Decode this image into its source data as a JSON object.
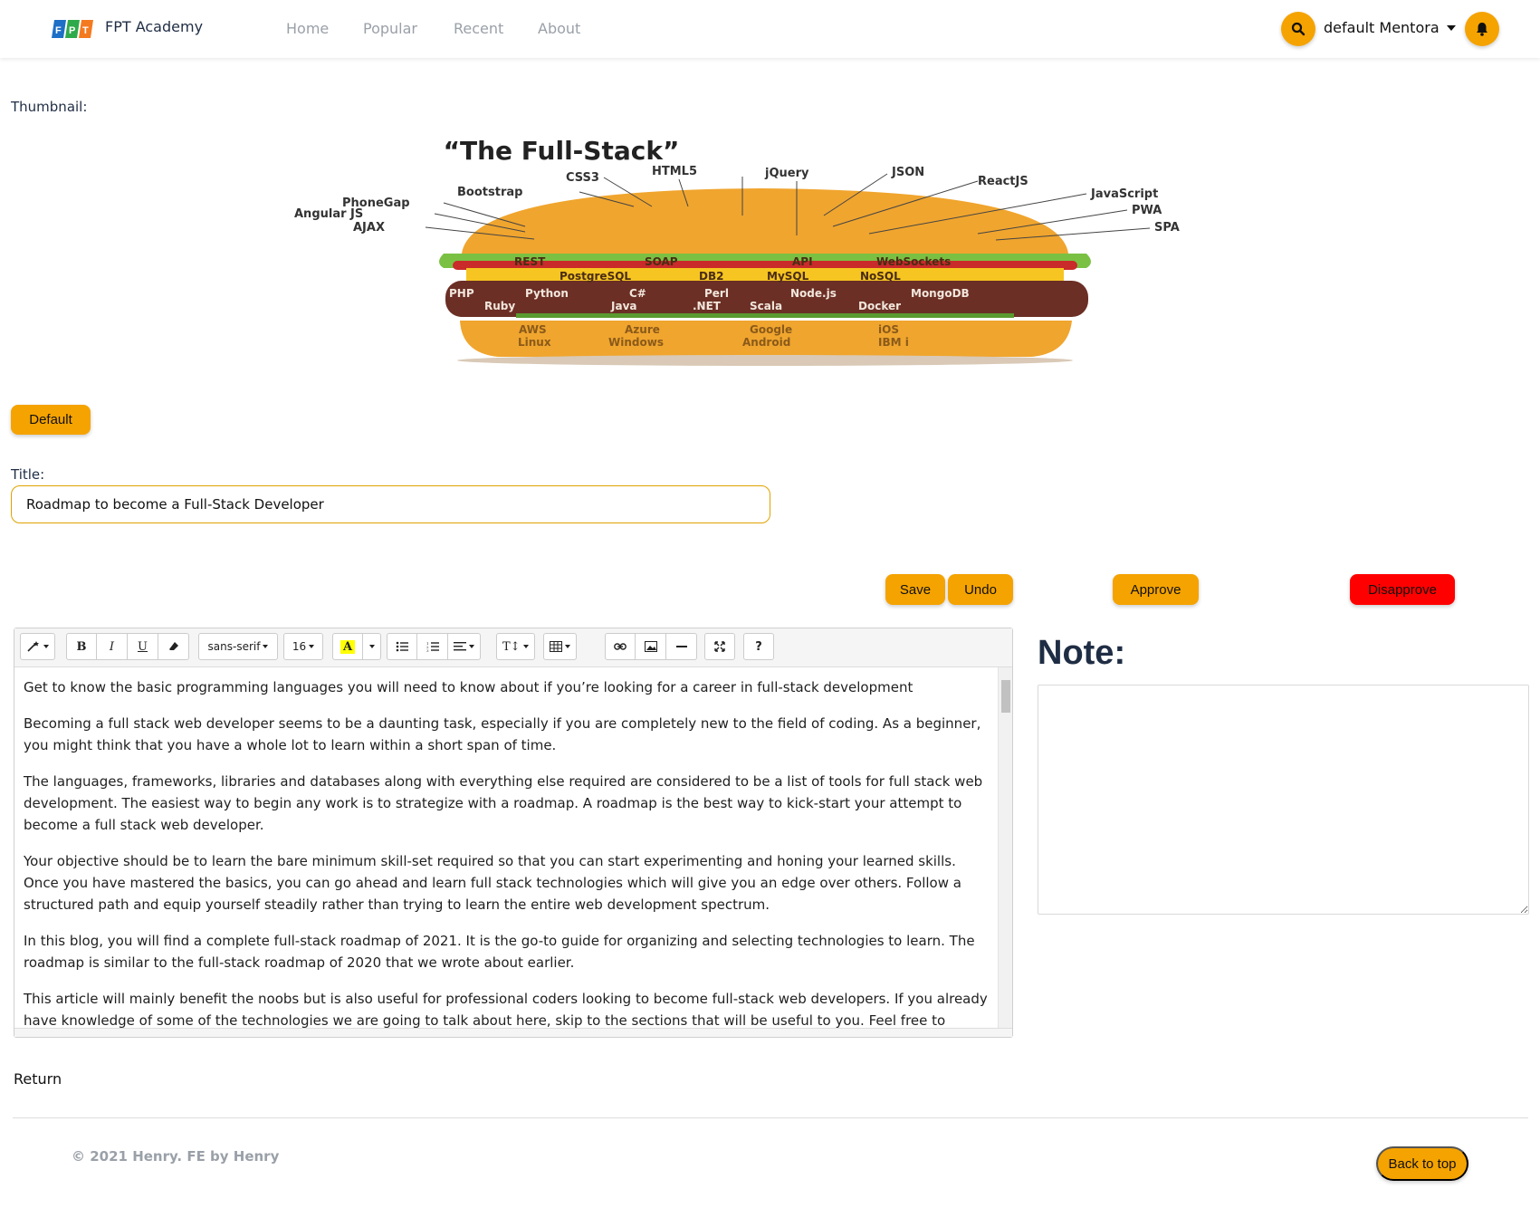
{
  "navbar": {
    "brand": "FPT Academy",
    "logo_text": "FPT",
    "links": [
      "Home",
      "Popular",
      "Recent",
      "About"
    ],
    "user_name": "default Mentora",
    "accent_color": "#f5a300"
  },
  "thumbnail": {
    "label": "Thumbnail:",
    "image": {
      "title": "“The Full-Stack”",
      "top_labels": [
        "CSS3",
        "HTML5",
        "jQuery",
        "JSON",
        "ReactJS",
        "Bootstrap",
        "JavaScript",
        "PhoneGap",
        "PWA",
        "Angular JS",
        "AJAX",
        "SPA"
      ],
      "layers": {
        "lettuce": [
          "REST",
          "SOAP",
          "API",
          "WebSockets"
        ],
        "cheese": [
          "PostgreSQL",
          "DB2",
          "MySQL",
          "NoSQL"
        ],
        "patty_row1": [
          "PHP",
          "Python",
          "C#",
          "Perl",
          "Node.js",
          "MongoDB"
        ],
        "patty_row2": [
          "Ruby",
          "Java",
          ".NET",
          "Scala",
          "Docker"
        ],
        "bun_row1": [
          "AWS",
          "Azure",
          "Google",
          "iOS"
        ],
        "bun_row2": [
          "Linux",
          "Windows",
          "Android",
          "IBM i"
        ]
      }
    },
    "default_button": "Default"
  },
  "title_field": {
    "label": "Title:",
    "value": "Roadmap to become a Full-Stack Developer"
  },
  "actions": {
    "save": "Save",
    "undo": "Undo",
    "approve": "Approve",
    "disapprove": "Disapprove"
  },
  "editor": {
    "toolbar": {
      "font_family": "sans-serif",
      "font_size": "16"
    },
    "paragraphs": [
      "Get to know the basic programming languages you will need to know about if you’re looking for a career in full-stack development",
      "Becoming a full stack web developer seems to be a daunting task, especially if you are completely new to the field of coding. As a beginner, you might think that you have a whole lot to learn within a short span of time.",
      "The languages, frameworks, libraries and databases along with everything else required are considered to be a list of tools for full stack web development. The easiest way to begin any work is to strategize with a roadmap. A roadmap is the best way to kick-start your attempt to become a full stack web developer.",
      "Your objective should be to learn the bare minimum skill-set required so that you can start experimenting and honing your learned skills. Once you have mastered the basics, you can go ahead and learn full stack technologies which will give you an edge over others. Follow a structured path and equip yourself steadily rather than trying to learn the entire web development spectrum.",
      "In this blog, you will find a complete full-stack roadmap of 2021. It is the go-to guide for organizing and selecting technologies to learn. The roadmap is similar to the full-stack roadmap of 2020 that we wrote about earlier.",
      "This article will mainly benefit the noobs but is also useful for professional coders looking to become full-stack web developers. If you already have knowledge of some of the technologies we are going to talk about here, skip to the sections that will be useful to you. Feel free to"
    ]
  },
  "note": {
    "heading": "Note:",
    "value": ""
  },
  "return_link": "Return",
  "footer": {
    "copyright": "© 2021 Henry. FE by Henry",
    "back_to_top": "Back to top"
  }
}
